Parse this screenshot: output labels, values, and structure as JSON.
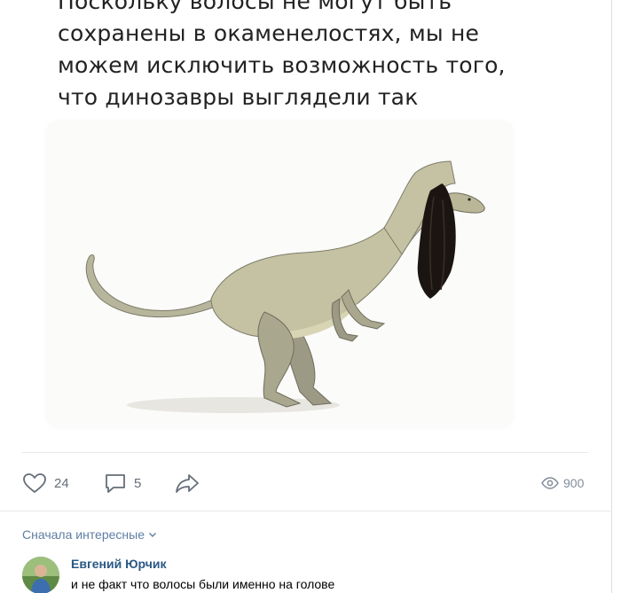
{
  "post": {
    "meme_caption": "Поскольку волосы не могут быть сохранены в окаменелостях, мы не можем исключить возможность того, что динозавры выглядели так",
    "meme_image": "dinosaur-with-long-black-hair"
  },
  "actions": {
    "likes": "24",
    "comments": "5",
    "views": "900"
  },
  "comments_section": {
    "sort_label": "Сначала интересные",
    "items": [
      {
        "author": "Евгений Юрчик",
        "text": "и не факт что волосы были именно на голове"
      }
    ]
  },
  "colors": {
    "link": "#2a5885",
    "sort_link": "#5e7da3",
    "action_icon": "#656d78",
    "muted": "#818c99",
    "divider": "#e7e8ec"
  }
}
